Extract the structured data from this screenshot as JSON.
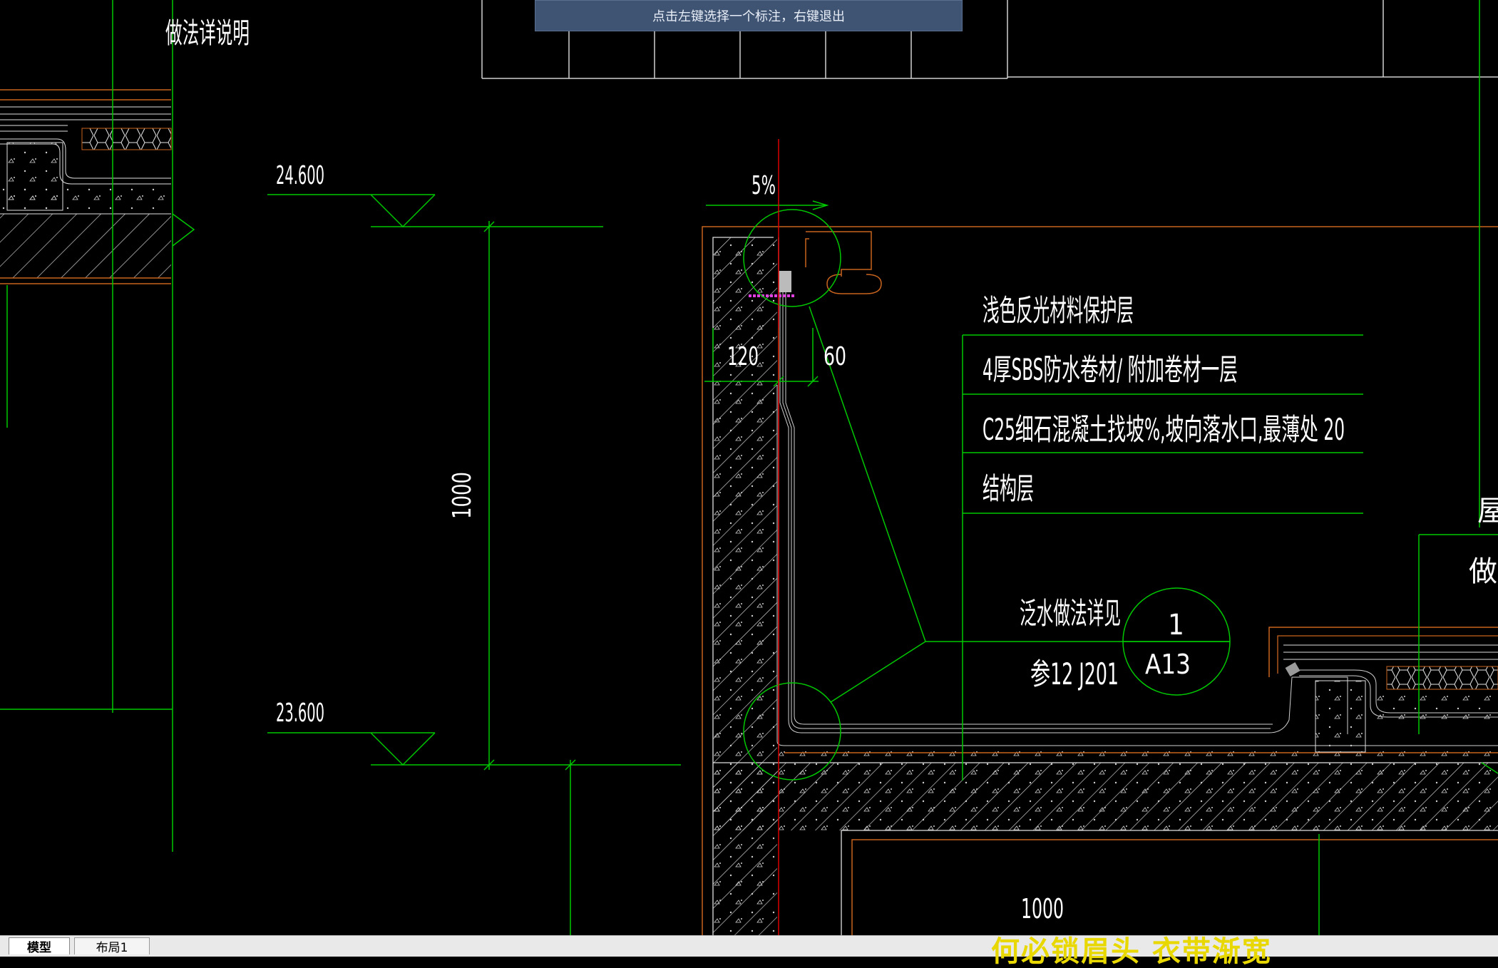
{
  "command_tip": "点击左键选择一个标注，右键退出",
  "labels": {
    "detail_title": "做法详说明",
    "elev_top": "24.600",
    "elev_bottom": "23.600",
    "dim_height": "1000",
    "slope": "5%",
    "dim_120": "120",
    "dim_60": "60",
    "layer1": "浅色反光材料保护层",
    "layer2": "4厚SBS防水卷材/ 附加卷材一层",
    "layer3": "C25细石混凝土找坡%,坡向落水口,最薄处 20",
    "layer4": "结构层",
    "flashing_ref": "泛水做法详见",
    "atlas_ref": "参12 J201",
    "callout_number": "1",
    "callout_sheet": "A13",
    "dim_bottom": "1000",
    "right_partial1": "屋",
    "right_partial2": "做法"
  },
  "tabs": {
    "model": "模型",
    "layout1": "布局1"
  },
  "ad_banner": "何必锁眉头 衣带渐宽",
  "colors": {
    "background": "#000000",
    "green": "#00c800",
    "orange": "#c8641e",
    "red": "#dc0000",
    "magenta": "#e040e0",
    "white": "#ffffff",
    "tip_bg": "#3f5373"
  }
}
